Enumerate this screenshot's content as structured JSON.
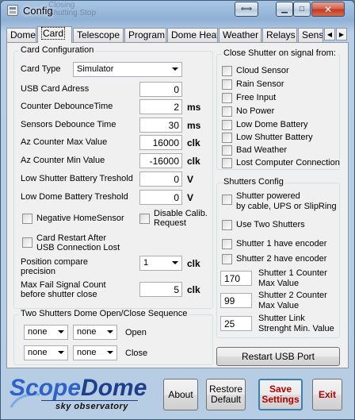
{
  "window": {
    "title": "Config",
    "ghost_title": "Closing Shutting Stop"
  },
  "tabs": [
    {
      "label": "Dome"
    },
    {
      "label": "Card"
    },
    {
      "label": "Telescope"
    },
    {
      "label": "Program"
    },
    {
      "label": "Dome Heat"
    },
    {
      "label": "Weather"
    },
    {
      "label": "Relays"
    },
    {
      "label": "Senso"
    }
  ],
  "card_config": {
    "legend": "Card Configuration",
    "card_type_label": "Card Type",
    "card_type_value": "Simulator",
    "fields": [
      {
        "label": "USB Card Adress",
        "value": "0",
        "unit": ""
      },
      {
        "label": "Counter DebounceTime",
        "value": "2",
        "unit": "ms"
      },
      {
        "label": "Sensors Debounce Time",
        "value": "30",
        "unit": "ms"
      },
      {
        "label": "Az Counter Max Value",
        "value": "16000",
        "unit": "clk"
      },
      {
        "label": "Az Counter Min Value",
        "value": "-16000",
        "unit": "clk"
      },
      {
        "label": "Low Shutter Battery Treshold",
        "value": "0",
        "unit": "V"
      },
      {
        "label": "Low Dome Battery Treshold",
        "value": "0",
        "unit": "V"
      }
    ],
    "negative_home_sensor": "Negative HomeSensor",
    "disable_calib_1": "Disable Calib.",
    "disable_calib_2": "Request",
    "card_restart_1": "Card Restart After",
    "card_restart_2": "USB Connection Lost",
    "position_compare_1": "Position compare",
    "position_compare_2": "precision",
    "position_compare_value": "1",
    "position_compare_unit": "clk",
    "max_fail_1": "Max Fail Signal Count",
    "max_fail_2": "before shutter close",
    "max_fail_value": "5",
    "max_fail_unit": "clk"
  },
  "close_shutter": {
    "legend": "Close Shutter on signal from:",
    "items": [
      {
        "label": "Cloud Sensor"
      },
      {
        "label": "Rain Sensor"
      },
      {
        "label": "Free Input"
      },
      {
        "label": "No Power"
      },
      {
        "label": "Low Dome Battery"
      },
      {
        "label": "Low Shutter Battery"
      },
      {
        "label": "Bad Weather"
      },
      {
        "label": "Lost Computer Connection"
      }
    ]
  },
  "shutters_config": {
    "legend": "Shutters Config",
    "powered_1": "Shutter powered",
    "powered_2": "by cable, UPS or SlipRing",
    "use_two": "Use Two Shutters",
    "s1_encoder": "Shutter 1 have encoder",
    "s2_encoder": "Shutter 2 have encoder",
    "s1_counter_value": "170",
    "s1_counter_1": "Shutter 1 Counter",
    "s1_counter_2": "Max Value",
    "s2_counter_value": "99",
    "s2_counter_1": "Shutter 2 Counter",
    "s2_counter_2": "Max Value",
    "link_value": "25",
    "link_1": "Shutter Link",
    "link_2": "Strenght Min. Value"
  },
  "sequence": {
    "legend": "Two Shutters Dome Open/Close Sequence",
    "open_a": "none",
    "open_b": "none",
    "open_label": "Open",
    "close_a": "none",
    "close_b": "none",
    "close_label": "Close"
  },
  "restart_usb_label": "Restart USB Port",
  "logo": {
    "scope": "Scope",
    "dome": "Dome",
    "subtitle": "sky observatory"
  },
  "buttons": {
    "about": "About",
    "restore_1": "Restore",
    "restore_2": "Default",
    "save_1": "Save",
    "save_2": "Settings",
    "exit": "Exit"
  }
}
